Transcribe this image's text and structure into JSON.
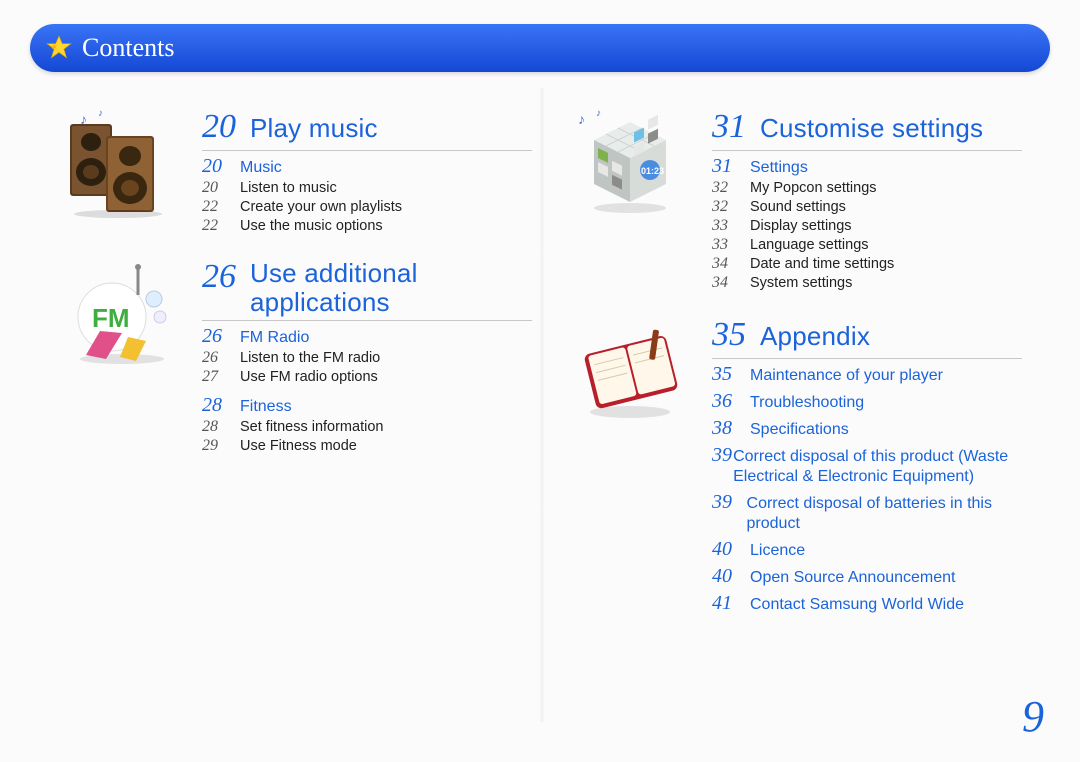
{
  "header": {
    "title": "Contents"
  },
  "page_number": "9",
  "left_column": [
    {
      "icon": "speakers",
      "page": "20",
      "title": "Play music",
      "sections": [
        {
          "page": "20",
          "title": "Music",
          "subs": [
            {
              "page": "20",
              "title": "Listen to music"
            },
            {
              "page": "22",
              "title": "Create your own playlists"
            },
            {
              "page": "22",
              "title": "Use the music options"
            }
          ]
        }
      ]
    },
    {
      "icon": "fm",
      "page": "26",
      "title_line1": "Use additional",
      "title_line2": "applications",
      "sections": [
        {
          "page": "26",
          "title": "FM Radio",
          "subs": [
            {
              "page": "26",
              "title": "Listen to the FM radio"
            },
            {
              "page": "27",
              "title": "Use FM radio options"
            }
          ]
        },
        {
          "page": "28",
          "title": "Fitness",
          "subs": [
            {
              "page": "28",
              "title": "Set fitness information"
            },
            {
              "page": "29",
              "title": "Use Fitness mode"
            }
          ]
        }
      ]
    }
  ],
  "right_column": [
    {
      "icon": "cube",
      "page": "31",
      "title": "Customise settings",
      "sections": [
        {
          "page": "31",
          "title": "Settings",
          "subs": [
            {
              "page": "32",
              "title": "My Popcon settings"
            },
            {
              "page": "32",
              "title": "Sound settings"
            },
            {
              "page": "33",
              "title": "Display settings"
            },
            {
              "page": "33",
              "title": "Language settings"
            },
            {
              "page": "34",
              "title": "Date and time settings"
            },
            {
              "page": "34",
              "title": "System settings"
            }
          ]
        }
      ]
    },
    {
      "icon": "notebook",
      "page": "35",
      "title": "Appendix",
      "sections_flat": [
        {
          "page": "35",
          "title": "Maintenance of your player"
        },
        {
          "page": "36",
          "title": "Troubleshooting"
        },
        {
          "page": "38",
          "title": "Specifications"
        },
        {
          "page": "39",
          "title": "Correct disposal of this product (Waste Electrical & Electronic Equipment)"
        },
        {
          "page": "39",
          "title": "Correct disposal of batteries in this product"
        },
        {
          "page": "40",
          "title": "Licence"
        },
        {
          "page": "40",
          "title": "Open Source Announcement"
        },
        {
          "page": "41",
          "title": "Contact Samsung World Wide"
        }
      ]
    }
  ]
}
